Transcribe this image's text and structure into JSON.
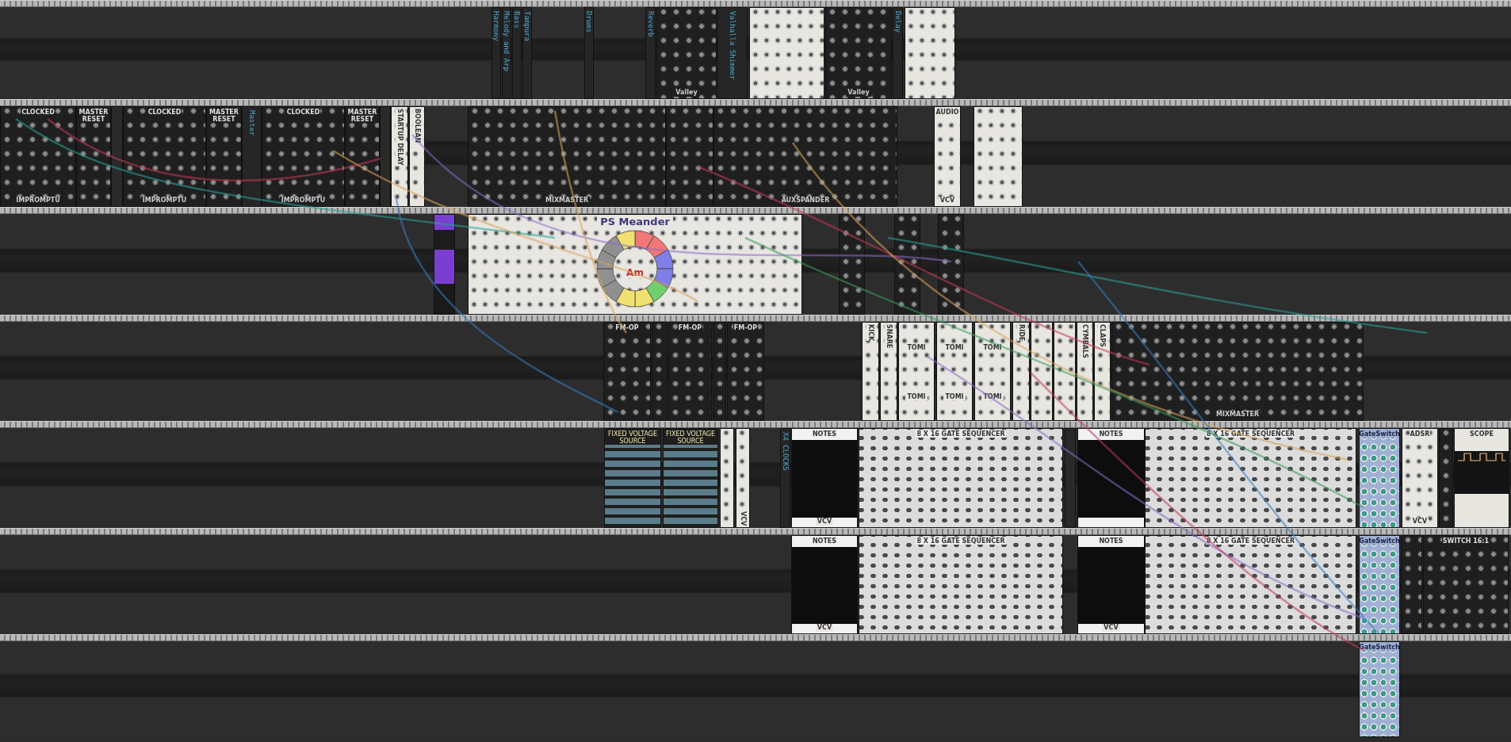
{
  "rack_rows": [
    {
      "modules": [
        {
          "kind": "label",
          "label": "Harmony"
        },
        {
          "kind": "label",
          "label": "Melody and Arp"
        },
        {
          "kind": "label",
          "label": "Bass"
        },
        {
          "kind": "label",
          "label": "Tampura"
        },
        {
          "kind": "label",
          "label": "Drums"
        },
        {
          "kind": "label",
          "label": "Reverb"
        },
        {
          "kind": "dark",
          "footer": "Valley"
        },
        {
          "kind": "label",
          "label": "Valhalla Shimmer"
        },
        {
          "kind": "light"
        },
        {
          "kind": "dark",
          "footer": "Valley"
        },
        {
          "kind": "label",
          "label": "Delay"
        },
        {
          "kind": "light"
        }
      ]
    },
    {
      "modules": [
        {
          "kind": "dark",
          "title": "CLOCKED",
          "footer": "IMPROMPTU"
        },
        {
          "kind": "dark",
          "title": "MASTER RESET"
        },
        {
          "kind": "blank"
        },
        {
          "kind": "dark",
          "title": "CLOCKED",
          "footer": "IMPROMPTU"
        },
        {
          "kind": "dark",
          "title": "MASTER RESET"
        },
        {
          "kind": "label",
          "label": "Master"
        },
        {
          "kind": "dark",
          "title": "CLOCKED",
          "footer": "IMPROMPTU"
        },
        {
          "kind": "dark",
          "title": "MASTER RESET"
        },
        {
          "kind": "blank"
        },
        {
          "kind": "light",
          "title": "STARTUP DELAY"
        },
        {
          "kind": "light",
          "title": "BOOLEAN"
        },
        {
          "kind": "dark",
          "footer": "MIXMASTER"
        },
        {
          "kind": "dark"
        },
        {
          "kind": "dark",
          "footer": "AUXSPANDER"
        },
        {
          "kind": "light",
          "title": "AUDIO",
          "footer": "VCV"
        },
        {
          "kind": "light"
        }
      ]
    },
    {
      "modules": [
        {
          "kind": "purple"
        },
        {
          "kind": "meander",
          "title": "PS  Meander",
          "center": "Am"
        },
        {
          "kind": "dark"
        },
        {
          "kind": "dark"
        },
        {
          "kind": "dark"
        }
      ]
    },
    {
      "modules": [
        {
          "kind": "dark",
          "title": "FM-OP"
        },
        {
          "kind": "dark"
        },
        {
          "kind": "dark",
          "title": "FM-OP"
        },
        {
          "kind": "dark"
        },
        {
          "kind": "dark",
          "title": "FM-OP"
        },
        {
          "kind": "light",
          "title": "KICK"
        },
        {
          "kind": "light",
          "title": "SNARE"
        },
        {
          "kind": "tomi",
          "titles": [
            "TOMI",
            "TOMI"
          ]
        },
        {
          "kind": "tomi",
          "titles": [
            "TOMI",
            "TOMI"
          ]
        },
        {
          "kind": "tomi",
          "titles": [
            "TOMI",
            "TOMI"
          ]
        },
        {
          "kind": "light",
          "title": "RIDE"
        },
        {
          "kind": "light"
        },
        {
          "kind": "light"
        },
        {
          "kind": "light",
          "title": "CYMBALS"
        },
        {
          "kind": "light",
          "title": "CLAPS"
        },
        {
          "kind": "dark",
          "footer": "MIXMASTER"
        }
      ]
    },
    {
      "modules": [
        {
          "kind": "voltage",
          "title": "FIXED VOLTAGE SOURCE"
        },
        {
          "kind": "voltage",
          "title": "FIXED VOLTAGE SOURCE"
        },
        {
          "kind": "light"
        },
        {
          "kind": "light",
          "footer": "VCV"
        },
        {
          "kind": "label",
          "label": "X4 CLOCKS"
        },
        {
          "kind": "screen",
          "title": "NOTES",
          "footer": "VCV"
        },
        {
          "kind": "sequencer",
          "title": "8 X 16 GATE SEQUENCER"
        },
        {
          "kind": "blank"
        },
        {
          "kind": "screen",
          "title": "NOTES"
        },
        {
          "kind": "sequencer",
          "title": "8 X 16 GATE SEQUENCER"
        },
        {
          "kind": "gateswitch",
          "title": "GateSwitch"
        },
        {
          "kind": "light",
          "title": "ADSR",
          "footer": "VCV"
        },
        {
          "kind": "dark"
        },
        {
          "kind": "scope",
          "title": "SCOPE"
        }
      ]
    },
    {
      "modules": [
        {
          "kind": "screen",
          "title": "NOTES",
          "footer": "VCV"
        },
        {
          "kind": "sequencer",
          "title": "8 X 16 GATE SEQUENCER"
        },
        {
          "kind": "screen",
          "title": "NOTES",
          "footer": "VCV"
        },
        {
          "kind": "sequencer",
          "title": "8 X 16 GATE SEQUENCER"
        },
        {
          "kind": "gateswitch",
          "title": "GateSwitch"
        },
        {
          "kind": "dark"
        },
        {
          "kind": "dark",
          "title": "SWITCH 16:1"
        }
      ]
    },
    {
      "modules": [
        {
          "kind": "gateswitch",
          "title": "GateSwitch"
        }
      ]
    }
  ]
}
